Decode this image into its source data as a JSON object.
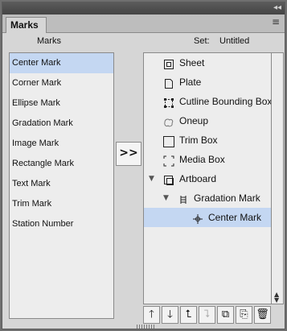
{
  "window": {
    "tab_label": "Marks",
    "collapse_glyph": "◂◂",
    "menu_glyph": "≡"
  },
  "left_panel": {
    "header": "Marks",
    "items": [
      {
        "label": "Center Mark",
        "selected": true
      },
      {
        "label": "Corner Mark",
        "selected": false
      },
      {
        "label": "Ellipse Mark",
        "selected": false
      },
      {
        "label": "Gradation Mark",
        "selected": false
      },
      {
        "label": "Image Mark",
        "selected": false
      },
      {
        "label": "Rectangle Mark",
        "selected": false
      },
      {
        "label": "Text Mark",
        "selected": false
      },
      {
        "label": "Trim Mark",
        "selected": false
      },
      {
        "label": "Station Number",
        "selected": false
      }
    ]
  },
  "transfer_button": {
    "label": ">>"
  },
  "right_panel": {
    "set_label": "Set:",
    "set_name": "Untitled",
    "tree": [
      {
        "label": "Sheet",
        "icon": "sheet-icon",
        "depth": 0,
        "twisty": "",
        "selected": false
      },
      {
        "label": "Plate",
        "icon": "plate-icon",
        "depth": 0,
        "twisty": "",
        "selected": false
      },
      {
        "label": "Cutline Bounding Box",
        "icon": "cutline-bounding-box-icon",
        "depth": 0,
        "twisty": "",
        "selected": false
      },
      {
        "label": "Oneup",
        "icon": "oneup-icon",
        "depth": 0,
        "twisty": "",
        "selected": false
      },
      {
        "label": "Trim Box",
        "icon": "trim-box-icon",
        "depth": 0,
        "twisty": "",
        "selected": false
      },
      {
        "label": "Media Box",
        "icon": "media-box-icon",
        "depth": 0,
        "twisty": "",
        "selected": false
      },
      {
        "label": "Artboard",
        "icon": "artboard-icon",
        "depth": 0,
        "twisty": "▼",
        "selected": false
      },
      {
        "label": "Gradation Mark",
        "icon": "gradation-mark-icon",
        "depth": 1,
        "twisty": "▼",
        "selected": false
      },
      {
        "label": "Center Mark",
        "icon": "center-mark-icon",
        "depth": 2,
        "twisty": "",
        "selected": true
      }
    ]
  },
  "scrollbar": {
    "up_glyph": "▲",
    "down_glyph": "▼"
  },
  "toolbar": {
    "buttons": [
      {
        "name": "move-up-button",
        "glyph": "🡑",
        "enabled": true
      },
      {
        "name": "move-down-button",
        "glyph": "🡓",
        "enabled": true
      },
      {
        "name": "move-out-button",
        "glyph": "⮤",
        "enabled": true
      },
      {
        "name": "move-in-button",
        "glyph": "⮧",
        "enabled": false
      },
      {
        "name": "duplicate-button",
        "glyph": "⧉",
        "enabled": true
      },
      {
        "name": "rename-button",
        "glyph": "⎘",
        "enabled": true
      },
      {
        "name": "delete-button",
        "glyph": "🗑",
        "enabled": true
      }
    ]
  }
}
